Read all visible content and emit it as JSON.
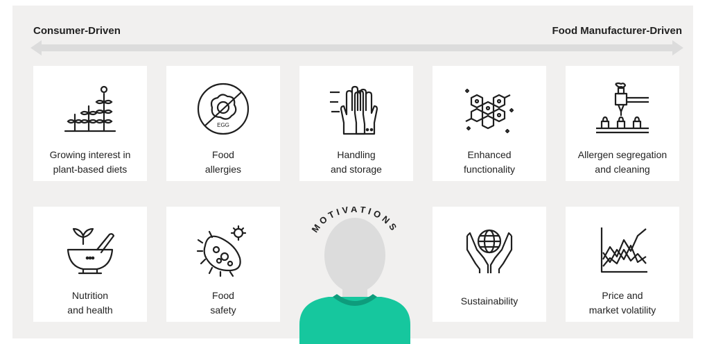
{
  "axis": {
    "left_label": "Consumer-Driven",
    "right_label": "Food Manufacturer-Driven"
  },
  "center": {
    "title": "MOTIVATIONS"
  },
  "cards": [
    {
      "label": "Growing interest in\nplant-based diets",
      "icon": "plant-sprouts-icon"
    },
    {
      "label": "Food\nallergies",
      "icon": "no-egg-icon",
      "icon_text": "EGG"
    },
    {
      "label": "Handling\nand storage",
      "icon": "gloved-hands-icon"
    },
    {
      "label": "Enhanced\nfunctionality",
      "icon": "molecule-icon"
    },
    {
      "label": "Allergen segregation\nand cleaning",
      "icon": "factory-dispenser-icon"
    },
    {
      "label": "Nutrition\nand health",
      "icon": "mortar-pestle-icon"
    },
    {
      "label": "Food\nsafety",
      "icon": "bacteria-icon"
    },
    {
      "label": "Sustainability",
      "icon": "hands-globe-icon"
    },
    {
      "label": "Price and\nmarket volatility",
      "icon": "volatility-chart-icon"
    }
  ],
  "colors": {
    "panel": "#f1f0ef",
    "arrow": "#dcdcdc",
    "person_head": "#dcdcdc",
    "shirt": "#16c79e",
    "collar": "#0e9c7c",
    "ink": "#1e1e1e"
  }
}
